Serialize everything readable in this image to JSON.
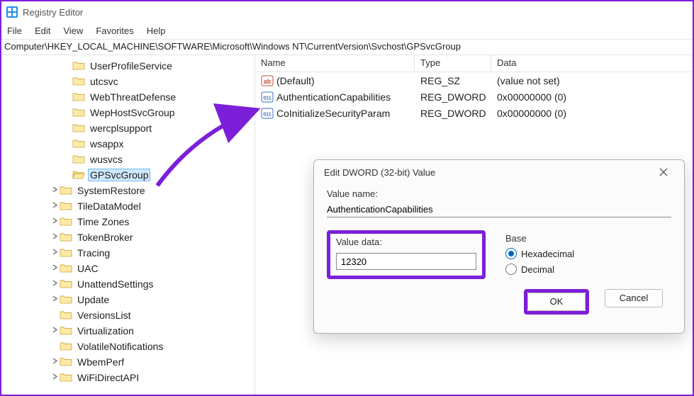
{
  "window": {
    "title": "Registry Editor"
  },
  "menu": {
    "file": "File",
    "edit": "Edit",
    "view": "View",
    "favorites": "Favorites",
    "help": "Help"
  },
  "addressbar": "Computer\\HKEY_LOCAL_MACHINE\\SOFTWARE\\Microsoft\\Windows NT\\CurrentVersion\\Svchost\\GPSvcGroup",
  "tree": {
    "items": [
      {
        "label": "UserProfileService",
        "indent": 86,
        "haschild": false,
        "icon": "closed"
      },
      {
        "label": "utcsvc",
        "indent": 86,
        "haschild": false,
        "icon": "closed"
      },
      {
        "label": "WebThreatDefense",
        "indent": 86,
        "haschild": false,
        "icon": "closed"
      },
      {
        "label": "WepHostSvcGroup",
        "indent": 86,
        "haschild": false,
        "icon": "closed"
      },
      {
        "label": "wercplsupport",
        "indent": 86,
        "haschild": false,
        "icon": "closed"
      },
      {
        "label": "wsappx",
        "indent": 86,
        "haschild": false,
        "icon": "closed"
      },
      {
        "label": "wusvcs",
        "indent": 86,
        "haschild": false,
        "icon": "closed"
      },
      {
        "label": "GPSvcGroup",
        "indent": 86,
        "haschild": false,
        "icon": "open",
        "selected": true
      },
      {
        "label": "SystemRestore",
        "indent": 68,
        "haschild": true,
        "icon": "closed"
      },
      {
        "label": "TileDataModel",
        "indent": 68,
        "haschild": true,
        "icon": "closed"
      },
      {
        "label": "Time Zones",
        "indent": 68,
        "haschild": true,
        "icon": "closed"
      },
      {
        "label": "TokenBroker",
        "indent": 68,
        "haschild": true,
        "icon": "closed"
      },
      {
        "label": "Tracing",
        "indent": 68,
        "haschild": true,
        "icon": "closed"
      },
      {
        "label": "UAC",
        "indent": 68,
        "haschild": true,
        "icon": "closed"
      },
      {
        "label": "UnattendSettings",
        "indent": 68,
        "haschild": true,
        "icon": "closed"
      },
      {
        "label": "Update",
        "indent": 68,
        "haschild": true,
        "icon": "closed"
      },
      {
        "label": "VersionsList",
        "indent": 68,
        "haschild": false,
        "icon": "closed"
      },
      {
        "label": "Virtualization",
        "indent": 68,
        "haschild": true,
        "icon": "closed"
      },
      {
        "label": "VolatileNotifications",
        "indent": 68,
        "haschild": false,
        "icon": "closed"
      },
      {
        "label": "WbemPerf",
        "indent": 68,
        "haschild": true,
        "icon": "closed"
      },
      {
        "label": "WiFiDirectAPI",
        "indent": 68,
        "haschild": true,
        "icon": "closed"
      }
    ]
  },
  "values": {
    "header": {
      "name": "Name",
      "type": "Type",
      "data": "Data"
    },
    "rows": [
      {
        "icon": "sz",
        "name": "(Default)",
        "type": "REG_SZ",
        "data": "(value not set)"
      },
      {
        "icon": "dword",
        "name": "AuthenticationCapabilities",
        "type": "REG_DWORD",
        "data": "0x00000000 (0)"
      },
      {
        "icon": "dword",
        "name": "CoInitializeSecurityParam",
        "type": "REG_DWORD",
        "data": "0x00000000 (0)"
      }
    ]
  },
  "dialog": {
    "title": "Edit DWORD (32-bit) Value",
    "valueNameLabel": "Value name:",
    "valueName": "AuthenticationCapabilities",
    "valueDataLabel": "Value data:",
    "valueData": "12320",
    "baseLabel": "Base",
    "hex": "Hexadecimal",
    "dec": "Decimal",
    "ok": "OK",
    "cancel": "Cancel"
  },
  "colors": {
    "highlight": "#7c1fd8",
    "selection": "#cde8ff",
    "accent": "#0067c0"
  }
}
